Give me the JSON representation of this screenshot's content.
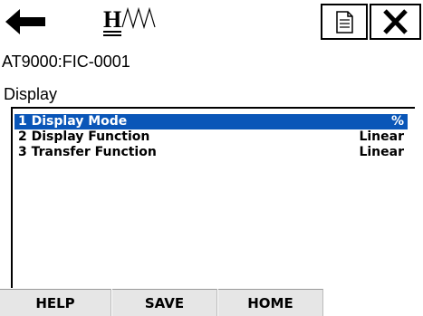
{
  "header": {
    "device_tag": "AT9000:FIC-0001",
    "menu_title": "Display",
    "icons": {
      "back": "back-arrow-icon",
      "logo": "hart-logo",
      "doc": "document-icon",
      "close": "close-icon"
    }
  },
  "menu": {
    "items": [
      {
        "label": "1 Display Mode",
        "value": "%",
        "selected": true
      },
      {
        "label": "2 Display Function",
        "value": "Linear",
        "selected": false
      },
      {
        "label": "3 Transfer Function",
        "value": "Linear",
        "selected": false
      }
    ]
  },
  "footer": {
    "help_label": "HELP",
    "save_label": "SAVE",
    "home_label": "HOME"
  },
  "colors": {
    "selection": "#0a56b8"
  }
}
